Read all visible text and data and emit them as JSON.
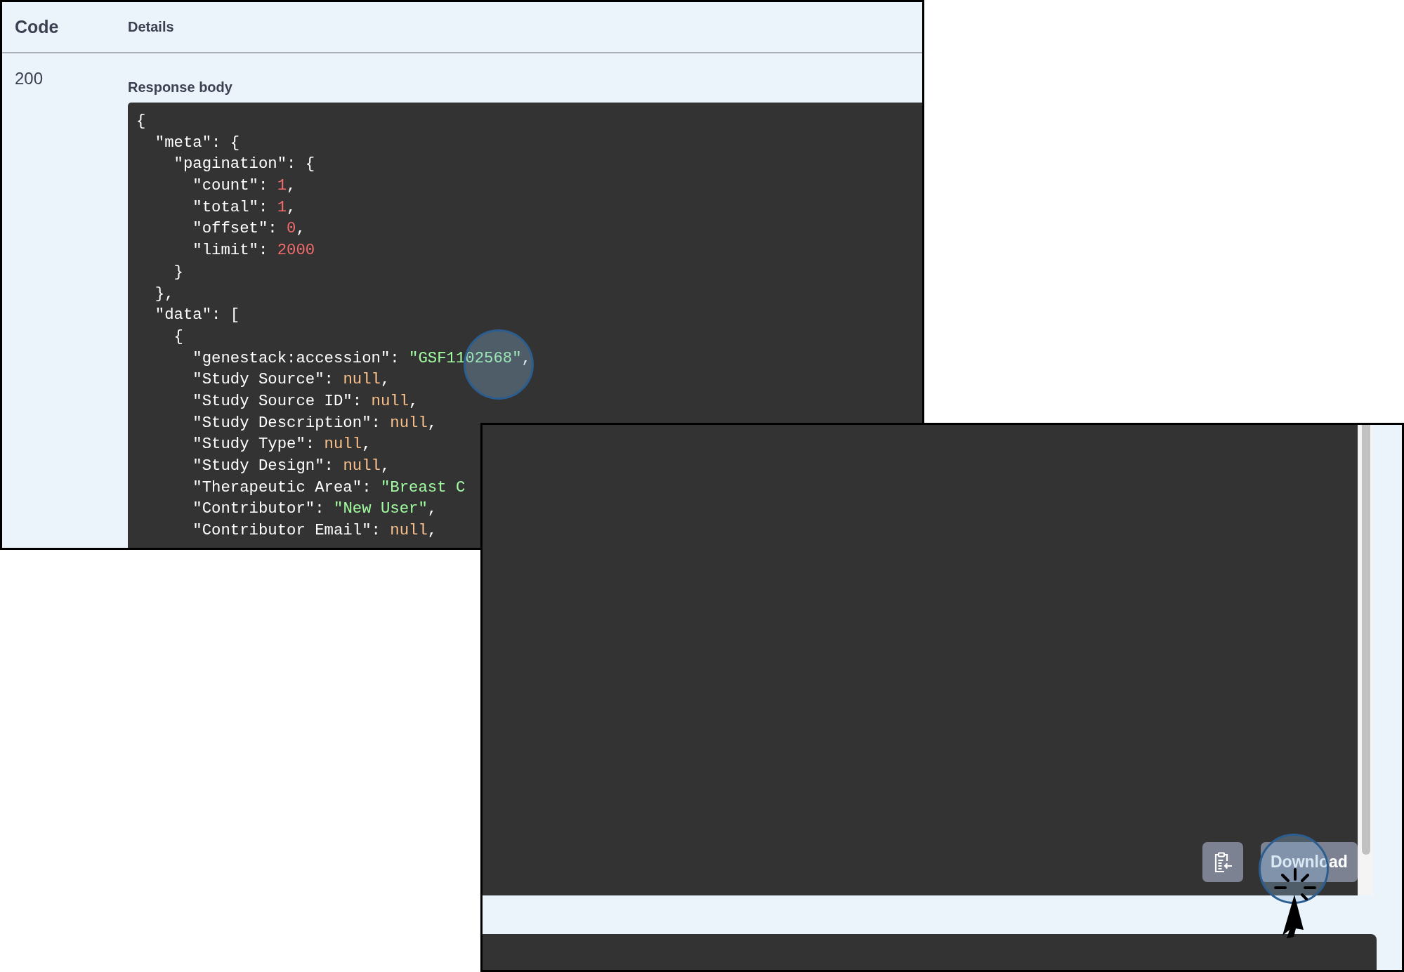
{
  "responses_header": {
    "code_label": "Code",
    "details_label": "Details"
  },
  "response": {
    "code": "200",
    "body_label": "Response body",
    "lines": [
      [
        {
          "text": "{",
          "kind": "plain"
        }
      ],
      [
        {
          "text": "  \"meta\": {",
          "kind": "plain"
        }
      ],
      [
        {
          "text": "    \"pagination\": {",
          "kind": "plain"
        }
      ],
      [
        {
          "text": "      \"count\": ",
          "kind": "plain"
        },
        {
          "text": "1",
          "kind": "number"
        },
        {
          "text": ",",
          "kind": "plain"
        }
      ],
      [
        {
          "text": "      \"total\": ",
          "kind": "plain"
        },
        {
          "text": "1",
          "kind": "number"
        },
        {
          "text": ",",
          "kind": "plain"
        }
      ],
      [
        {
          "text": "      \"offset\": ",
          "kind": "plain"
        },
        {
          "text": "0",
          "kind": "number"
        },
        {
          "text": ",",
          "kind": "plain"
        }
      ],
      [
        {
          "text": "      \"limit\": ",
          "kind": "plain"
        },
        {
          "text": "2000",
          "kind": "number"
        }
      ],
      [
        {
          "text": "    }",
          "kind": "plain"
        }
      ],
      [
        {
          "text": "  },",
          "kind": "plain"
        }
      ],
      [
        {
          "text": "  \"data\": [",
          "kind": "plain"
        }
      ],
      [
        {
          "text": "    {",
          "kind": "plain"
        }
      ],
      [
        {
          "text": "      \"genestack:accession\": ",
          "kind": "plain"
        },
        {
          "text": "\"GSF1102568\"",
          "kind": "string"
        },
        {
          "text": ",",
          "kind": "plain"
        }
      ],
      [
        {
          "text": "      \"Study Source\": ",
          "kind": "plain"
        },
        {
          "text": "null",
          "kind": "null"
        },
        {
          "text": ",",
          "kind": "plain"
        }
      ],
      [
        {
          "text": "      \"Study Source ID\": ",
          "kind": "plain"
        },
        {
          "text": "null",
          "kind": "null"
        },
        {
          "text": ",",
          "kind": "plain"
        }
      ],
      [
        {
          "text": "      \"Study Description\": ",
          "kind": "plain"
        },
        {
          "text": "null",
          "kind": "null"
        },
        {
          "text": ",",
          "kind": "plain"
        }
      ],
      [
        {
          "text": "      \"Study Type\": ",
          "kind": "plain"
        },
        {
          "text": "null",
          "kind": "null"
        },
        {
          "text": ",",
          "kind": "plain"
        }
      ],
      [
        {
          "text": "      \"Study Design\": ",
          "kind": "plain"
        },
        {
          "text": "null",
          "kind": "null"
        },
        {
          "text": ",",
          "kind": "plain"
        }
      ],
      [
        {
          "text": "      \"Therapeutic Area\": ",
          "kind": "plain"
        },
        {
          "text": "\"Breast C",
          "kind": "string"
        }
      ],
      [
        {
          "text": "      \"Contributor\": ",
          "kind": "plain"
        },
        {
          "text": "\"New User\"",
          "kind": "string"
        },
        {
          "text": ",",
          "kind": "plain"
        }
      ],
      [
        {
          "text": "      \"Contributor Email\": ",
          "kind": "plain"
        },
        {
          "text": "null",
          "kind": "null"
        },
        {
          "text": ",",
          "kind": "plain"
        }
      ]
    ]
  },
  "response_panel": {
    "buttons": [
      {
        "kind": "copy"
      },
      {
        "kind": "download",
        "label": "Download"
      }
    ]
  }
}
